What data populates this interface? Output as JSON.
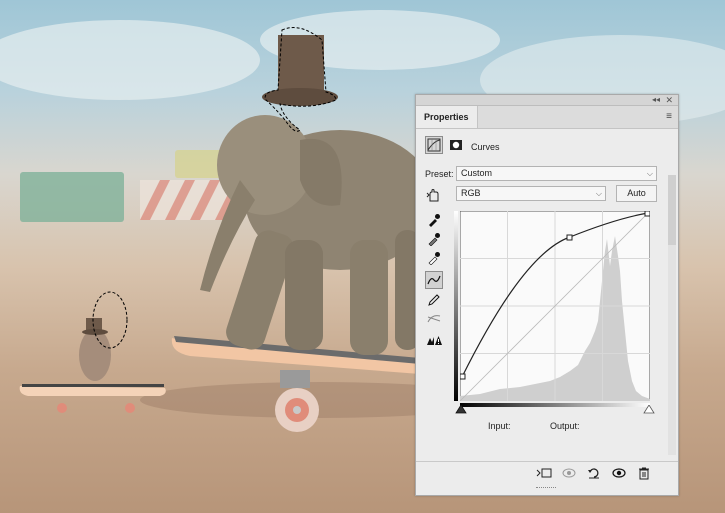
{
  "panel": {
    "tab_label": "Properties",
    "collapse_glyph": "◂◂",
    "close_glyph": "✕",
    "menu_glyph": "≡",
    "adjustment_title": "Curves",
    "preset_label": "Preset:",
    "preset_value": "Custom",
    "channel_value": "RGB",
    "auto_label": "Auto",
    "input_label": "Input:",
    "output_label": "Output:"
  },
  "icons": {
    "adjustment_icon": "curves-adjustment-icon",
    "mask_icon": "layer-mask-icon",
    "targeted_adjust": "hand-targeted-adjust-icon",
    "eyedropper_black": "eyedropper-black-icon",
    "eyedropper_gray": "eyedropper-gray-icon",
    "eyedropper_white": "eyedropper-white-icon",
    "curve_tool": "curve-edit-icon",
    "pencil_tool": "pencil-draw-icon",
    "smooth_tool": "smooth-curve-icon",
    "clip_warning": "clipping-warning-icon",
    "clip_to_layer": "clip-to-layer-icon",
    "view_previous": "view-previous-icon",
    "reset": "reset-icon",
    "visibility": "eye-icon",
    "delete": "trash-icon"
  },
  "colors": {
    "panel_bg": "#ececec",
    "curve": "#222222",
    "histogram": "#c8c8c8"
  }
}
